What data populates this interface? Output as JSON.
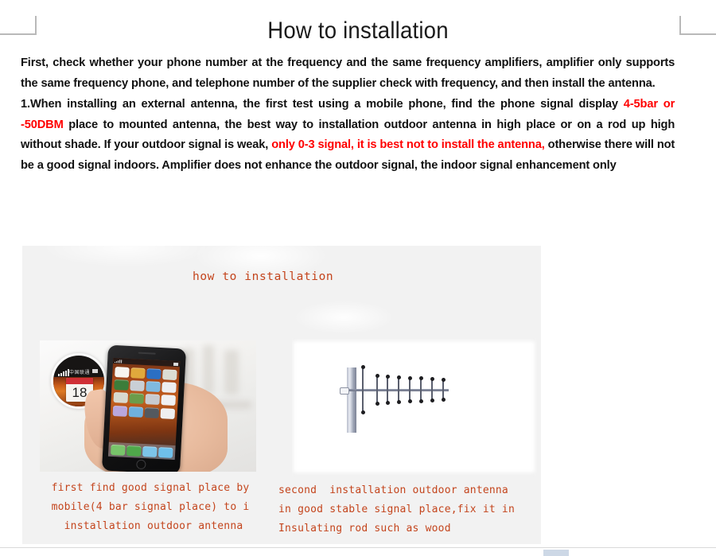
{
  "page": {
    "title": "How to installation",
    "corner_marks": [
      "top-left",
      "top-right"
    ]
  },
  "intro": {
    "text": "First, check whether your phone number at the frequency and the same frequency amplifiers, amplifier only supports the same frequency phone, and telephone number of the supplier check with frequency, and then install the antenna."
  },
  "step1": {
    "number": "1.",
    "seg1": "When installing an external antenna, the first test using a mobile phone, find the phone signal display ",
    "seg2_red": "4-5bar or -50DBM",
    "seg3": " place to mounted antenna, the best way to installation outdoor antenna in high place or on a rod up high without shade. If your outdoor signal is weak, ",
    "seg4_red": "only 0-3 signal, it is best not to install the antenna,",
    "seg5": " otherwise there will not be a good signal indoors. Amplifier does not enhance the outdoor signal, the indoor signal enhancement only"
  },
  "figure": {
    "heading": "how to installation",
    "left_photo_alt": "hand holding mobile phone with signal bars magnified",
    "right_photo_alt": "outdoor yagi directional antenna mounted on mast",
    "magnifier": {
      "carrier": "中国联通",
      "calendar_day": "18"
    },
    "caption_left": "first find good signal place by\nmobile(4 bar signal place) to i\n installation outdoor antenna",
    "caption_right": "second  installation outdoor antenna\nin good stable signal place,fix it in\nInsulating rod such as wood"
  },
  "colors": {
    "highlight_red": "#ff0000",
    "caption_orange": "#c4451d",
    "panel_background": "#f2f2f2",
    "body_text": "#111111"
  }
}
